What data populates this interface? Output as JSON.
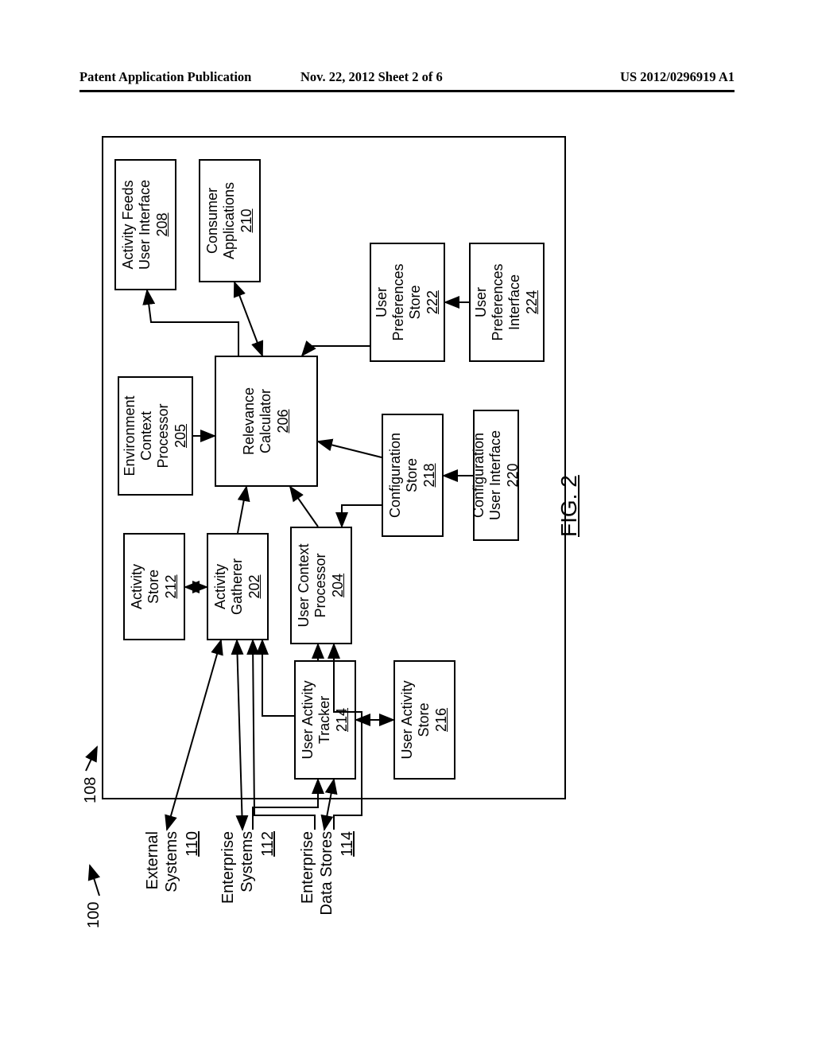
{
  "header": {
    "left": "Patent Application Publication",
    "mid": "Nov. 22, 2012  Sheet 2 of 6",
    "right": "US 2012/0296919 A1"
  },
  "figure_label": "FIG. 2",
  "ref_100": "100",
  "ref_108": "108",
  "external_systems": {
    "line1": "External",
    "line2": "Systems",
    "num": "110"
  },
  "enterprise_systems": {
    "line1": "Enterprise",
    "line2": "Systems",
    "num": "112"
  },
  "enterprise_data_stores": {
    "line1": "Enterprise",
    "line2": "Data Stores",
    "num": "114"
  },
  "boxes": {
    "activity_store": {
      "t1": "Activity",
      "t2": "Store",
      "num": "212"
    },
    "activity_gatherer": {
      "t1": "Activity",
      "t2": "Gatherer",
      "num": "202"
    },
    "user_context_proc": {
      "t1": "User Context",
      "t2": "Processor",
      "num": "204"
    },
    "env_context_proc": {
      "t1": "Environment",
      "t2": "Context",
      "t3": "Processor",
      "num": "205"
    },
    "relevance_calc": {
      "t1": "Relevance",
      "t2": "Calculator",
      "num": "206"
    },
    "activity_feeds_ui": {
      "t1": "Activity Feeds",
      "t2": "User Interface",
      "num": "208"
    },
    "consumer_apps": {
      "t1": "Consumer",
      "t2": "Applications",
      "num": "210"
    },
    "user_activity_tracker": {
      "t1": "User Activity",
      "t2": "Tracker",
      "num": "214"
    },
    "user_activity_store": {
      "t1": "User Activity",
      "t2": "Store",
      "num": "216"
    },
    "config_store": {
      "t1": "Configuration",
      "t2": "Store",
      "num": "218"
    },
    "config_ui": {
      "t1": "Configuration",
      "t2": "User Interface",
      "num": "220"
    },
    "user_pref_store": {
      "t1": "User",
      "t2": "Preferences",
      "t3": "Store",
      "num": "222"
    },
    "user_pref_ui": {
      "t1": "User",
      "t2": "Preferences",
      "t3": "Interface",
      "num": "224"
    }
  }
}
